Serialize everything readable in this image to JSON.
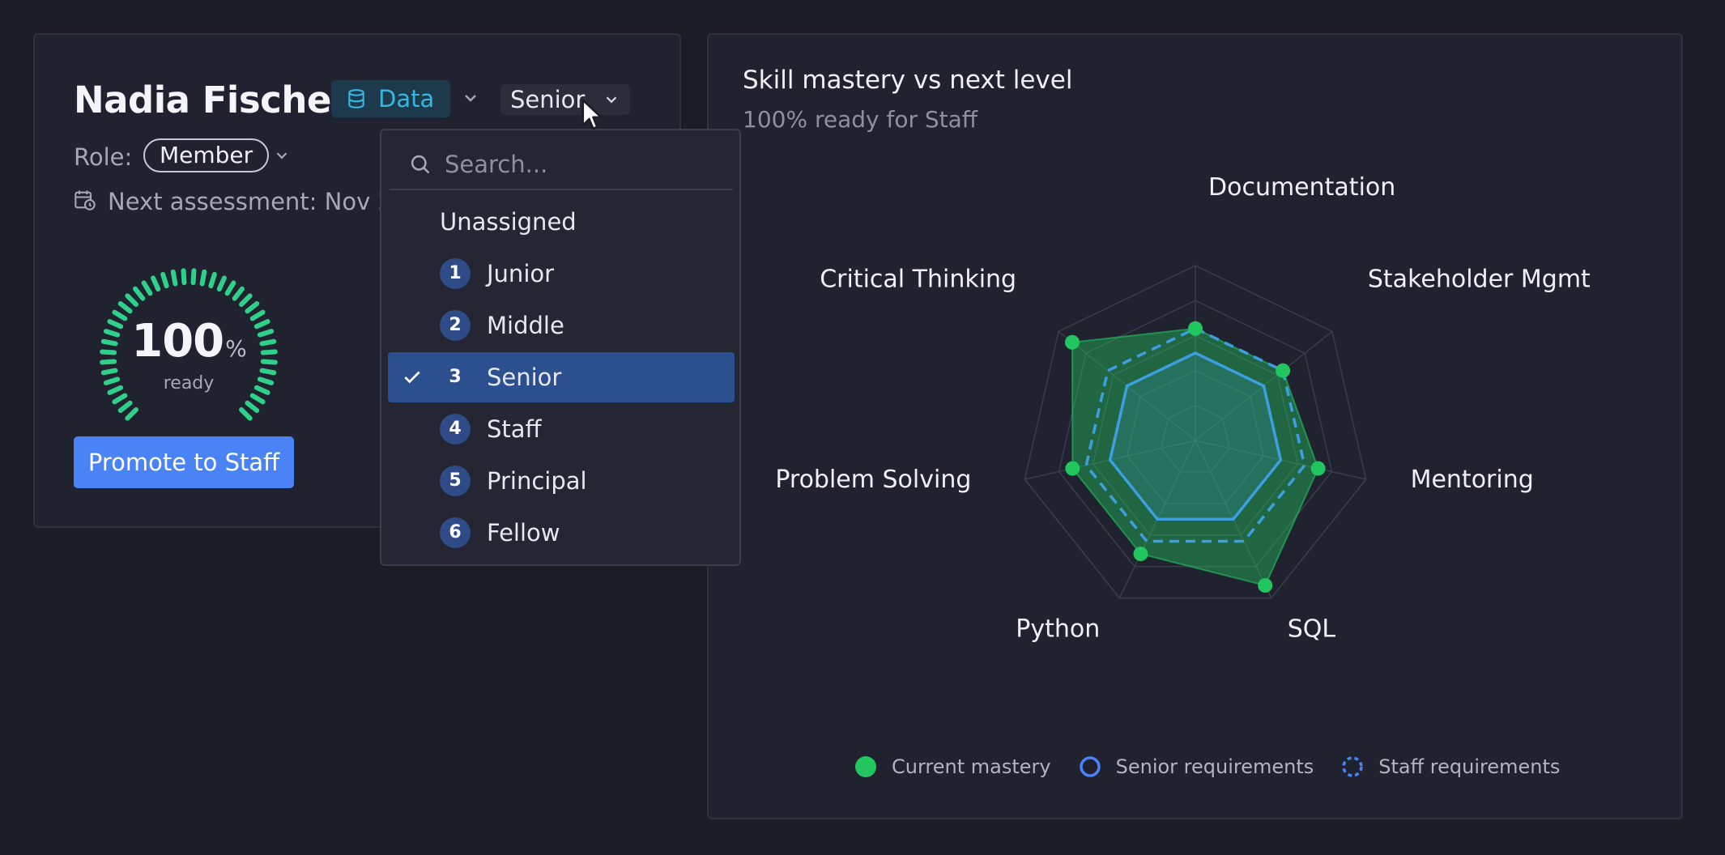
{
  "profile": {
    "name": "Nadia Fischer",
    "team": "Data",
    "level": "Senior",
    "role_label": "Role:",
    "role": "Member",
    "next_assessment": "Next assessment: Nov 24,",
    "readiness": {
      "value": "100",
      "unit": "%",
      "label": "ready",
      "fraction": 1.0
    },
    "promote_button": "Promote to Staff"
  },
  "level_dropdown": {
    "search_placeholder": "Search...",
    "options": [
      {
        "label": "Unassigned",
        "badge": ""
      },
      {
        "label": "Junior",
        "badge": "1"
      },
      {
        "label": "Middle",
        "badge": "2"
      },
      {
        "label": "Senior",
        "badge": "3",
        "selected": true
      },
      {
        "label": "Staff",
        "badge": "4"
      },
      {
        "label": "Principal",
        "badge": "5"
      },
      {
        "label": "Fellow",
        "badge": "6"
      }
    ]
  },
  "chart": {
    "title": "Skill mastery vs next level",
    "subtitle": "100% ready for Staff"
  },
  "chart_data": {
    "type": "radar",
    "categories": [
      "Documentation",
      "Stakeholder Mgmt",
      "Mentoring",
      "SQL",
      "Python",
      "Problem Solving",
      "Critical Thinking"
    ],
    "max": 5,
    "grid_levels": 5,
    "series": [
      {
        "name": "Current mastery",
        "values": [
          3.2,
          3.2,
          3.6,
          4.6,
          3.6,
          3.6,
          4.5
        ],
        "color": "#22c55e"
      },
      {
        "name": "Senior requirements",
        "values": [
          2.5,
          2.5,
          2.5,
          2.5,
          2.5,
          2.5,
          2.5
        ],
        "color": "#3b9fe0"
      },
      {
        "name": "Staff requirements",
        "values": [
          3.2,
          3.2,
          3.2,
          3.2,
          3.2,
          3.2,
          3.2
        ],
        "color": "#3b9fe0"
      }
    ],
    "legend": [
      "Current mastery",
      "Senior requirements",
      "Staff requirements"
    ],
    "legend_position": "bottom"
  },
  "colors": {
    "accent": "#4a83f6",
    "mastery": "#22c55e",
    "requirement": "#3b9fe0",
    "gauge": "#2fd18a"
  }
}
